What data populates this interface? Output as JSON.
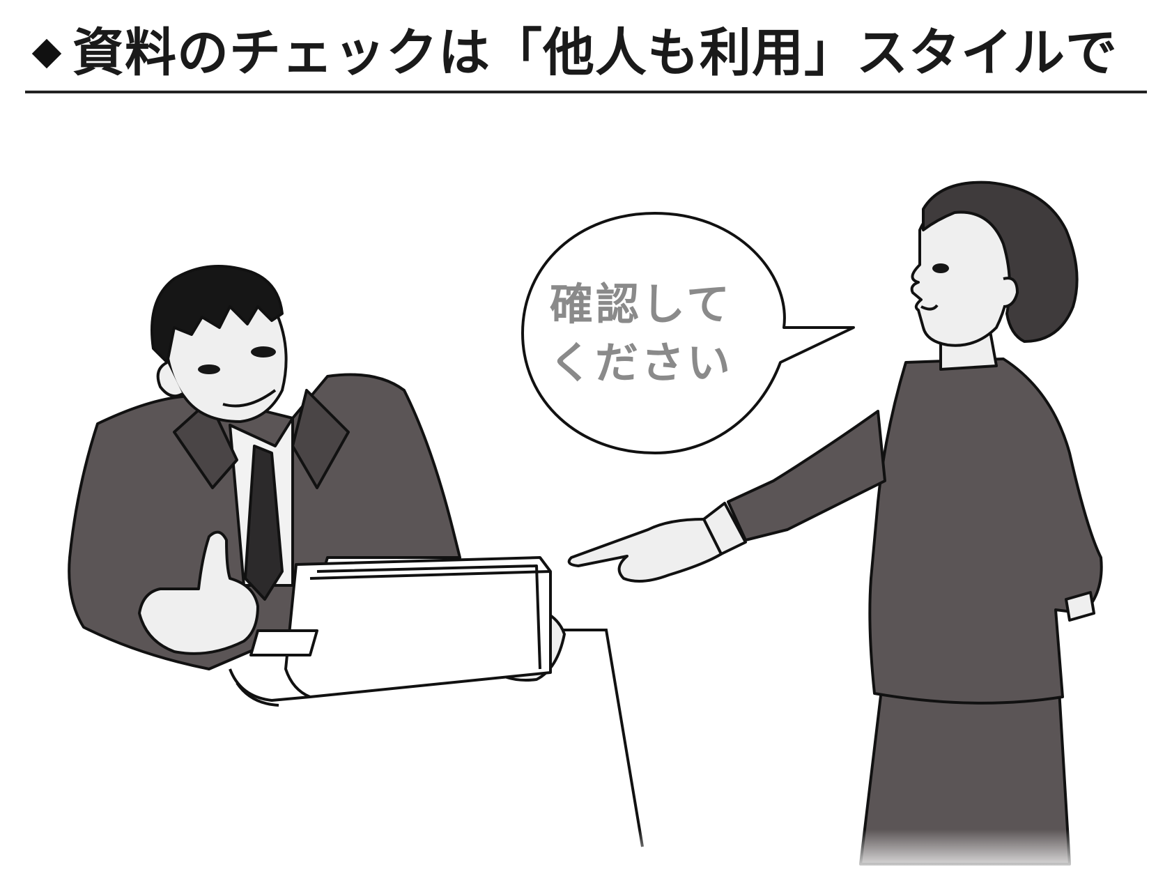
{
  "header": {
    "title": "資料のチェックは「他人も利用」スタイルで"
  },
  "speech_bubble": {
    "line1": "確認して",
    "line2": "ください"
  },
  "colors": {
    "suit": "#5b5556",
    "hair": "#161616",
    "line": "#111111",
    "skin": "#efefef",
    "bubble_text": "#8a8a8a"
  }
}
